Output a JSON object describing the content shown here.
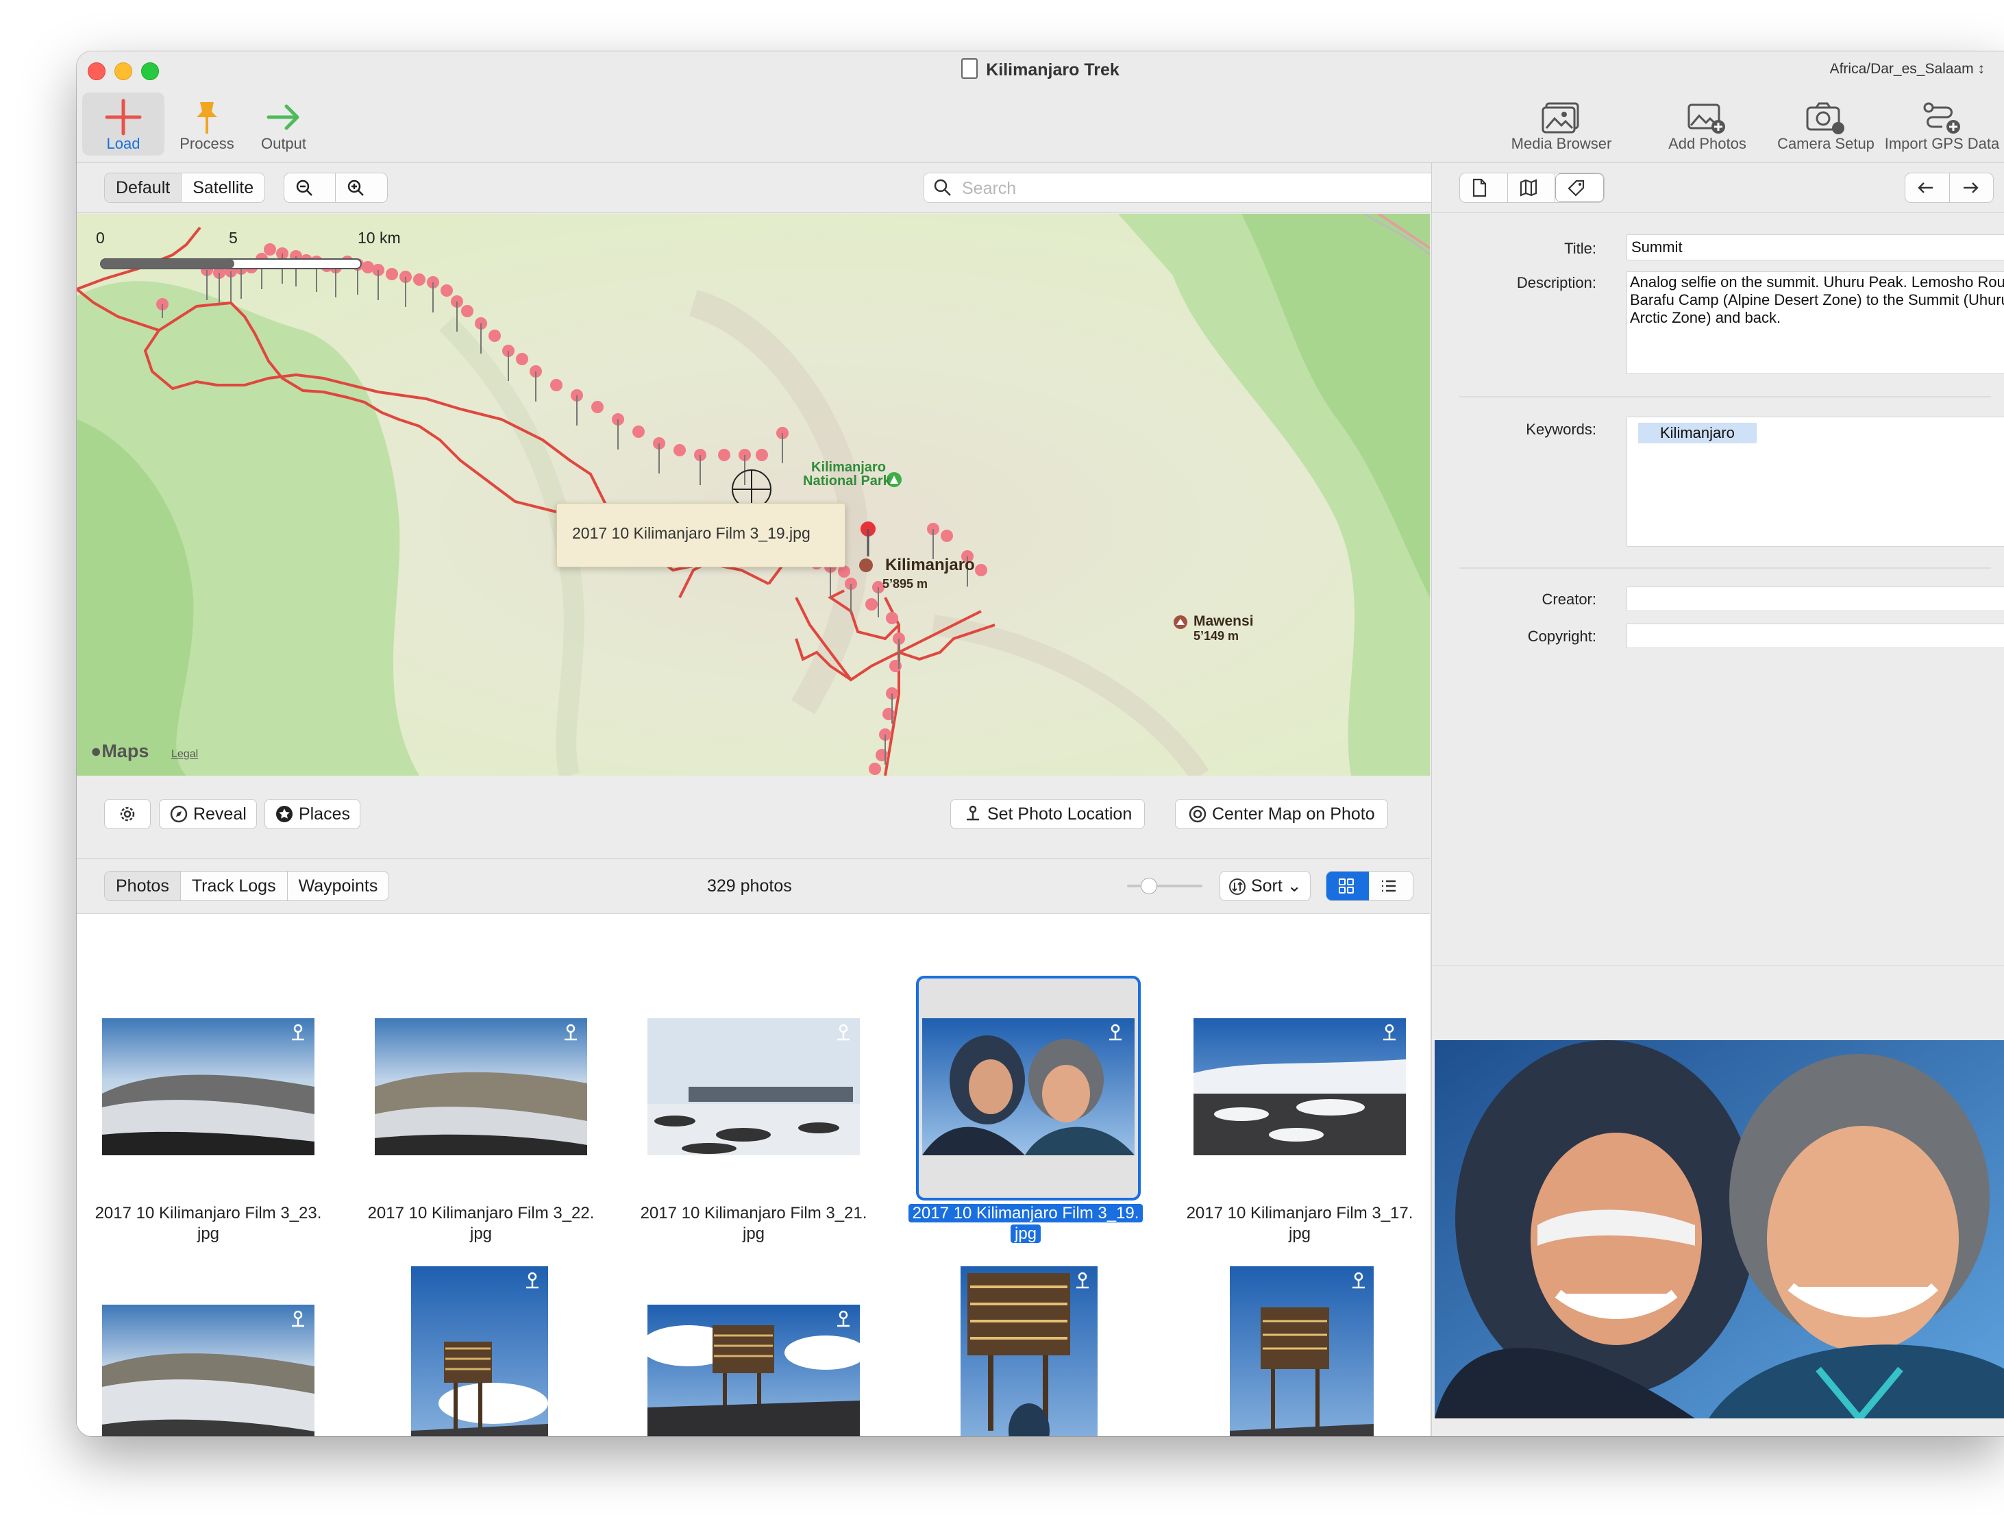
{
  "window": {
    "title": "Kilimanjaro Trek",
    "timezone": "Africa/Dar_es_Salaam ↕"
  },
  "toolbar": {
    "left": [
      {
        "label": "Load",
        "icon": "plus-icon"
      },
      {
        "label": "Process",
        "icon": "pin-icon"
      },
      {
        "label": "Output",
        "icon": "arrow-right-icon"
      }
    ],
    "right": [
      {
        "label": "Media Browser",
        "icon": "media-browser-icon"
      },
      {
        "label": "Add Photos",
        "icon": "add-photos-icon"
      },
      {
        "label": "Camera Setup",
        "icon": "camera-icon"
      },
      {
        "label": "Import GPS Data",
        "icon": "gps-import-icon"
      }
    ]
  },
  "map_bar": {
    "map_types": [
      "Default",
      "Satellite"
    ],
    "search_placeholder": "Search"
  },
  "map": {
    "scale_labels": [
      "0",
      "5",
      "10 km"
    ],
    "tooltip": "2017 10 Kilimanjaro Film 3_19.jpg",
    "park_label_1": "Kilimanjaro",
    "park_label_2": "National Park",
    "peak1_name": "Kilimanjaro",
    "peak1_elev": "5’895 m",
    "peak2_name": "Mawensi",
    "peak2_elev": "5’149 m",
    "logo": "Maps",
    "legal": "Legal",
    "route_color": "#e0473e",
    "pin_color": "#f07a86"
  },
  "map_controls": {
    "reveal": "Reveal",
    "places": "Places",
    "set_location": "Set Photo Location",
    "center_map": "Center Map on Photo"
  },
  "list_bar": {
    "tabs": [
      "Photos",
      "Track Logs",
      "Waypoints"
    ],
    "count": "329 photos",
    "sort": "Sort"
  },
  "photos": [
    {
      "name1": "2017 10 Kilimanjaro Film 3_23.",
      "name2": "jpg"
    },
    {
      "name1": "2017 10 Kilimanjaro Film 3_22.",
      "name2": "jpg"
    },
    {
      "name1": "2017 10 Kilimanjaro Film 3_21.",
      "name2": "jpg"
    },
    {
      "name1": "2017 10 Kilimanjaro Film 3_19.",
      "name2": "jpg"
    },
    {
      "name1": "2017 10 Kilimanjaro Film 3_17.",
      "name2": "jpg"
    }
  ],
  "details": {
    "title_label": "Title:",
    "title_value": "Summit",
    "description_label": "Description:",
    "description_value": "Analog selfie on the summit. Uhuru Peak. Lemosho Route from Barafu Camp (Alpine Desert Zone) to the Summit (Uhuru Peak - Arctic Zone) and back.",
    "keywords_label": "Keywords:",
    "keyword": "Kilimanjaro",
    "creator_label": "Creator:",
    "copyright_label": "Copyright:"
  },
  "colors": {
    "accent": "#1a6fe0",
    "load_icon": "#e8534a",
    "process_icon": "#f2a521",
    "output_icon": "#4cbb5a"
  }
}
